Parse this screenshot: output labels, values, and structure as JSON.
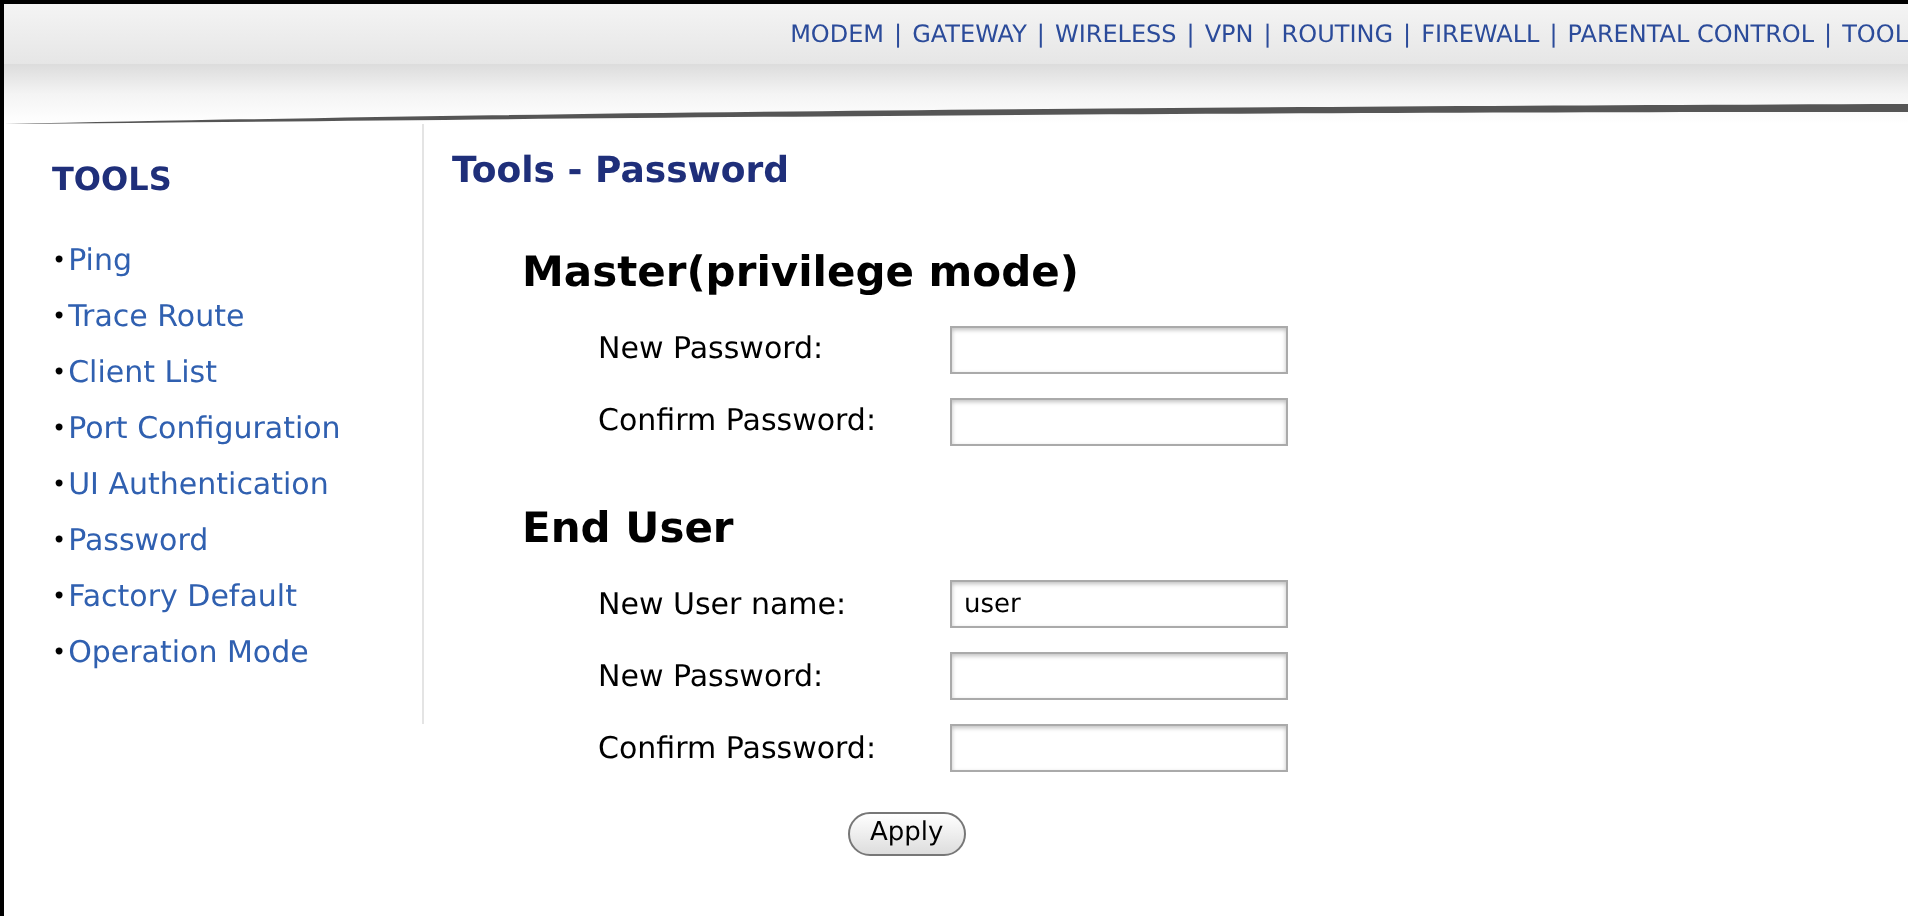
{
  "top_nav": [
    {
      "kind": "link",
      "label": "MODEM"
    },
    {
      "kind": "separator",
      "label": "|"
    },
    {
      "kind": "link",
      "label": "GATEWAY"
    },
    {
      "kind": "separator",
      "label": "|"
    },
    {
      "kind": "link",
      "label": "WIRELESS"
    },
    {
      "kind": "separator",
      "label": "|"
    },
    {
      "kind": "link",
      "label": "VPN"
    },
    {
      "kind": "separator",
      "label": "|"
    },
    {
      "kind": "link",
      "label": "ROUTING"
    },
    {
      "kind": "separator",
      "label": "|"
    },
    {
      "kind": "link",
      "label": "FIREWALL"
    },
    {
      "kind": "separator",
      "label": "|"
    },
    {
      "kind": "link",
      "label": "PARENTAL CONTROL"
    },
    {
      "kind": "separator",
      "label": "|"
    },
    {
      "kind": "link",
      "label": "TOOL"
    }
  ],
  "sidebar": {
    "title": "TOOLS",
    "items": [
      {
        "bullet": "•",
        "label": "Ping"
      },
      {
        "bullet": "•",
        "label": "Trace Route"
      },
      {
        "bullet": "•",
        "label": "Client List"
      },
      {
        "bullet": "•",
        "label": "Port Configuration"
      },
      {
        "bullet": "•",
        "label": "UI Authentication"
      },
      {
        "bullet": "•",
        "label": "Password"
      },
      {
        "bullet": "•",
        "label": "Factory Default"
      },
      {
        "bullet": "•",
        "label": "Operation Mode"
      }
    ]
  },
  "page_title": "Tools - Password",
  "sections": [
    {
      "heading": "Master(privilege mode)",
      "fields": [
        {
          "label": "New Password:"
        },
        {
          "label": "Confirm Password:"
        }
      ]
    },
    {
      "heading": "End User",
      "fields": [
        {
          "label": "New User name:",
          "value": "user"
        },
        {
          "label": "New Password:"
        },
        {
          "label": "Confirm Password:"
        }
      ]
    }
  ],
  "apply_button": "Apply"
}
